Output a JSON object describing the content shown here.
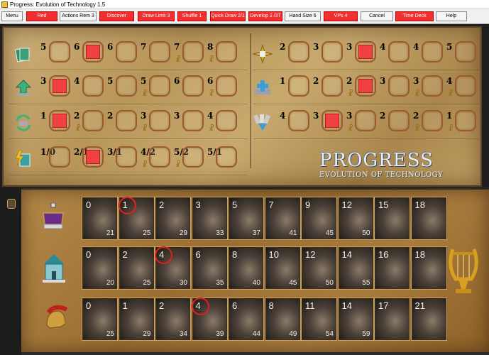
{
  "window": {
    "title": "Progress: Evolution of Technology 1.5"
  },
  "toolbar": {
    "buttons": [
      {
        "label": "Menu",
        "style": "plain"
      },
      {
        "label": "Red",
        "style": "red"
      },
      {
        "label": "Actions Rem 3",
        "style": "plain"
      },
      {
        "label": "Discover",
        "style": "red"
      },
      {
        "label": "Draw Limit 3",
        "style": "red"
      },
      {
        "label": "Shuffle 1",
        "style": "red"
      },
      {
        "label": "Quick Draw 2/1",
        "style": "red"
      },
      {
        "label": "Develop 2 /3T",
        "style": "red"
      },
      {
        "label": "Hand Size 6",
        "style": "plain"
      },
      {
        "label": "VPs 4",
        "style": "red"
      },
      {
        "label": "Cancel",
        "style": "plain"
      },
      {
        "label": "Time Deck",
        "style": "red"
      },
      {
        "label": "Help",
        "style": "plain"
      }
    ]
  },
  "board": {
    "left_tracks": [
      {
        "icon": "cards-icon",
        "cells": [
          {
            "num": "5",
            "filled": false,
            "lyre": false
          },
          {
            "num": "6",
            "filled": true,
            "lyre": false
          },
          {
            "num": "6",
            "filled": false,
            "lyre": false
          },
          {
            "num": "7",
            "filled": false,
            "lyre": false
          },
          {
            "num": "7",
            "filled": false,
            "lyre": true
          },
          {
            "num": "8",
            "filled": false,
            "lyre": true
          }
        ]
      },
      {
        "icon": "up-arrow-icon",
        "cells": [
          {
            "num": "3",
            "filled": true,
            "lyre": false
          },
          {
            "num": "4",
            "filled": false,
            "lyre": false
          },
          {
            "num": "5",
            "filled": false,
            "lyre": false
          },
          {
            "num": "5",
            "filled": false,
            "lyre": true
          },
          {
            "num": "6",
            "filled": false,
            "lyre": false
          },
          {
            "num": "6",
            "filled": false,
            "lyre": true
          }
        ]
      },
      {
        "icon": "recycle-icon",
        "cells": [
          {
            "num": "1",
            "filled": true,
            "lyre": false
          },
          {
            "num": "2",
            "filled": false,
            "lyre": true
          },
          {
            "num": "2",
            "filled": false,
            "lyre": false
          },
          {
            "num": "3",
            "filled": false,
            "lyre": true
          },
          {
            "num": "3",
            "filled": false,
            "lyre": false
          },
          {
            "num": "4",
            "filled": false,
            "lyre": true
          }
        ]
      },
      {
        "icon": "lightning-card-icon",
        "cells": [
          {
            "num": "1/0",
            "filled": false,
            "lyre": false
          },
          {
            "num": "2/1",
            "filled": true,
            "lyre": false
          },
          {
            "num": "3/1",
            "filled": false,
            "lyre": false
          },
          {
            "num": "4/2",
            "filled": false,
            "lyre": true
          },
          {
            "num": "5/2",
            "filled": false,
            "lyre": true
          },
          {
            "num": "5/1",
            "filled": false,
            "lyre": false
          }
        ]
      }
    ],
    "right_tracks": [
      {
        "icon": "compass-star-icon",
        "cells": [
          {
            "num": "2",
            "filled": false,
            "lyre": false
          },
          {
            "num": "3",
            "filled": false,
            "lyre": false
          },
          {
            "num": "3",
            "filled": true,
            "lyre": false
          },
          {
            "num": "4",
            "filled": false,
            "lyre": false
          },
          {
            "num": "4",
            "filled": false,
            "lyre": false
          },
          {
            "num": "5",
            "filled": false,
            "lyre": false
          }
        ]
      },
      {
        "icon": "plus-card-icon",
        "cells": [
          {
            "num": "1",
            "filled": false,
            "lyre": false
          },
          {
            "num": "2",
            "filled": false,
            "lyre": false
          },
          {
            "num": "2",
            "filled": true,
            "lyre": true
          },
          {
            "num": "3",
            "filled": false,
            "lyre": false
          },
          {
            "num": "3",
            "filled": false,
            "lyre": true
          },
          {
            "num": "4",
            "filled": false,
            "lyre": true
          }
        ]
      },
      {
        "icon": "hand-fan-icon",
        "cells": [
          {
            "num": "4",
            "filled": false,
            "lyre": false
          },
          {
            "num": "3",
            "filled": true,
            "lyre": false
          },
          {
            "num": "3",
            "filled": false,
            "lyre": true
          },
          {
            "num": "2",
            "filled": false,
            "lyre": false
          },
          {
            "num": "2",
            "filled": false,
            "lyre": true
          },
          {
            "num": "1",
            "filled": false,
            "lyre": true
          }
        ]
      }
    ],
    "logo_line1": "PROGRESS",
    "logo_line2": "EVOLUTION OF TECHNOLOGY"
  },
  "age_rows": [
    {
      "icon": "crown-icon",
      "cards": [
        {
          "top": "0",
          "bot": "21",
          "circled": false
        },
        {
          "top": "1",
          "bot": "25",
          "circled": true
        },
        {
          "top": "2",
          "bot": "29",
          "circled": false
        },
        {
          "top": "3",
          "bot": "33",
          "circled": false
        },
        {
          "top": "5",
          "bot": "37",
          "circled": false
        },
        {
          "top": "7",
          "bot": "41",
          "circled": false
        },
        {
          "top": "9",
          "bot": "45",
          "circled": false
        },
        {
          "top": "12",
          "bot": "50",
          "circled": false
        },
        {
          "top": "15",
          "bot": "",
          "circled": false
        },
        {
          "top": "18",
          "bot": "",
          "circled": false
        }
      ]
    },
    {
      "icon": "temple-icon",
      "cards": [
        {
          "top": "0",
          "bot": "20",
          "circled": false
        },
        {
          "top": "2",
          "bot": "25",
          "circled": false
        },
        {
          "top": "4",
          "bot": "30",
          "circled": true
        },
        {
          "top": "6",
          "bot": "35",
          "circled": false
        },
        {
          "top": "8",
          "bot": "40",
          "circled": false
        },
        {
          "top": "10",
          "bot": "45",
          "circled": false
        },
        {
          "top": "12",
          "bot": "50",
          "circled": false
        },
        {
          "top": "14",
          "bot": "55",
          "circled": false
        },
        {
          "top": "16",
          "bot": "",
          "circled": false
        },
        {
          "top": "18",
          "bot": "",
          "circled": false
        }
      ]
    },
    {
      "icon": "helmet-icon",
      "cards": [
        {
          "top": "0",
          "bot": "25",
          "circled": false
        },
        {
          "top": "1",
          "bot": "29",
          "circled": false
        },
        {
          "top": "2",
          "bot": "34",
          "circled": false
        },
        {
          "top": "4",
          "bot": "39",
          "circled": true
        },
        {
          "top": "6",
          "bot": "44",
          "circled": false
        },
        {
          "top": "8",
          "bot": "49",
          "circled": false
        },
        {
          "top": "11",
          "bot": "54",
          "circled": false
        },
        {
          "top": "14",
          "bot": "59",
          "circled": false
        },
        {
          "top": "17",
          "bot": "",
          "circled": false
        },
        {
          "top": "21",
          "bot": "",
          "circled": false
        }
      ]
    }
  ],
  "culture_icon": "lyre-icon",
  "colors": {
    "player_red": "#f04040",
    "parchment": "#c2a468"
  }
}
